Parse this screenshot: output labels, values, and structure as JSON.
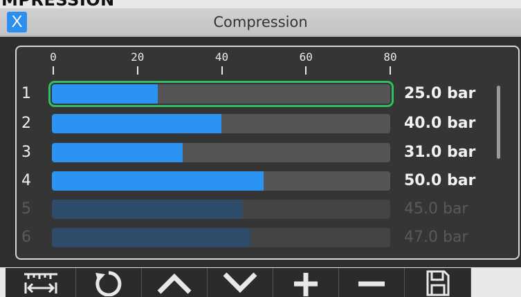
{
  "app_header": "MPRESSION",
  "window": {
    "title": "Compression",
    "close_label": "X"
  },
  "scale": {
    "ticks": [
      "0",
      "20",
      "40",
      "60",
      "80"
    ],
    "max": 80
  },
  "rows": [
    {
      "index": "1",
      "value": 25.0,
      "value_label": "25.0 bar",
      "selected": true,
      "faded": false
    },
    {
      "index": "2",
      "value": 40.0,
      "value_label": "40.0 bar",
      "selected": false,
      "faded": false
    },
    {
      "index": "3",
      "value": 31.0,
      "value_label": "31.0 bar",
      "selected": false,
      "faded": false
    },
    {
      "index": "4",
      "value": 50.0,
      "value_label": "50.0 bar",
      "selected": false,
      "faded": false
    },
    {
      "index": "5",
      "value": 45.0,
      "value_label": "45.0 bar",
      "selected": false,
      "faded": true
    },
    {
      "index": "6",
      "value": 47.0,
      "value_label": "47.0 bar",
      "selected": false,
      "faded": true
    }
  ],
  "toolbar": [
    {
      "name": "scale-ruler-icon"
    },
    {
      "name": "refresh-icon"
    },
    {
      "name": "chevron-up-icon"
    },
    {
      "name": "chevron-down-icon"
    },
    {
      "name": "plus-icon"
    },
    {
      "name": "minus-icon"
    },
    {
      "name": "save-icon"
    }
  ],
  "colors": {
    "accent": "#2b94f2",
    "selection": "#2ec062",
    "close_button": "#2b8ef0"
  }
}
